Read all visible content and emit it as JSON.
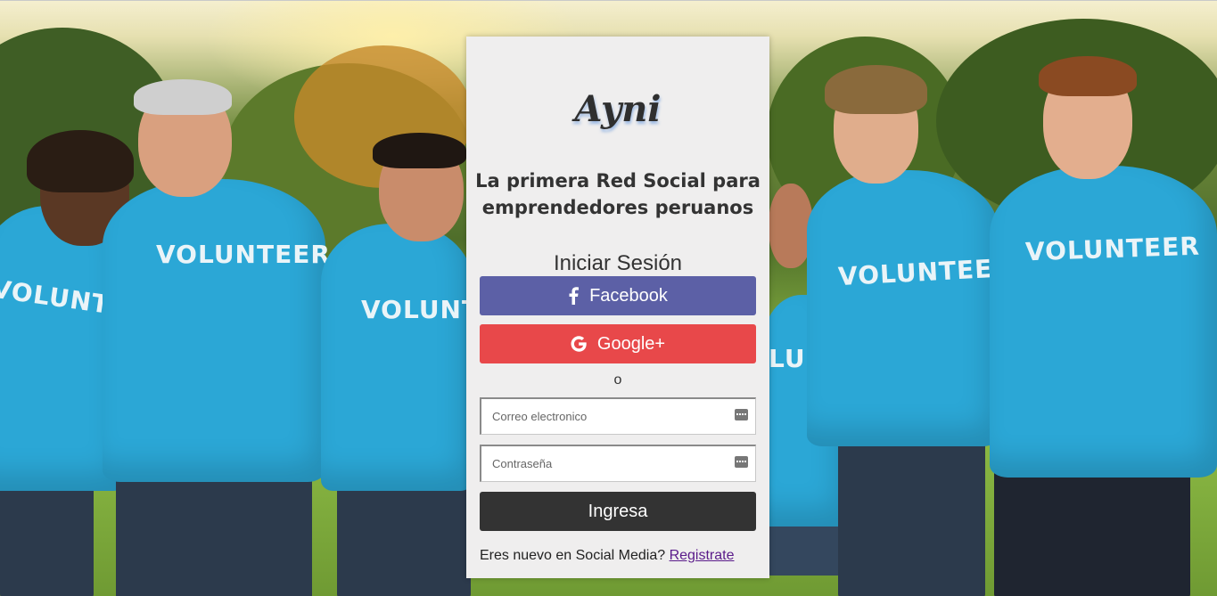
{
  "brand": {
    "logo_text": "Ayni"
  },
  "login": {
    "tagline_line1": "La primera Red Social para",
    "tagline_line2": "emprendedores peruanos",
    "title": "Iniciar Sesión",
    "facebook_label": "Facebook",
    "google_label": "Google+",
    "or_label": "o",
    "email_placeholder": "Correo electronico",
    "password_placeholder": "Contraseña",
    "submit_label": "Ingresa",
    "signup_prompt": "Eres nuevo en Social Media?",
    "signup_link": "Registrate"
  },
  "background": {
    "shirt_text": "VOLUNTEER"
  },
  "icons": {
    "facebook": "facebook-icon",
    "google": "google-icon",
    "email_field": "keyboard-icon",
    "password_field": "keyboard-icon"
  },
  "colors": {
    "facebook_button": "#5c60a6",
    "google_button": "#e8484a",
    "submit_button": "#333333",
    "card_background": "#efeeee",
    "link": "#5a1b8a"
  }
}
